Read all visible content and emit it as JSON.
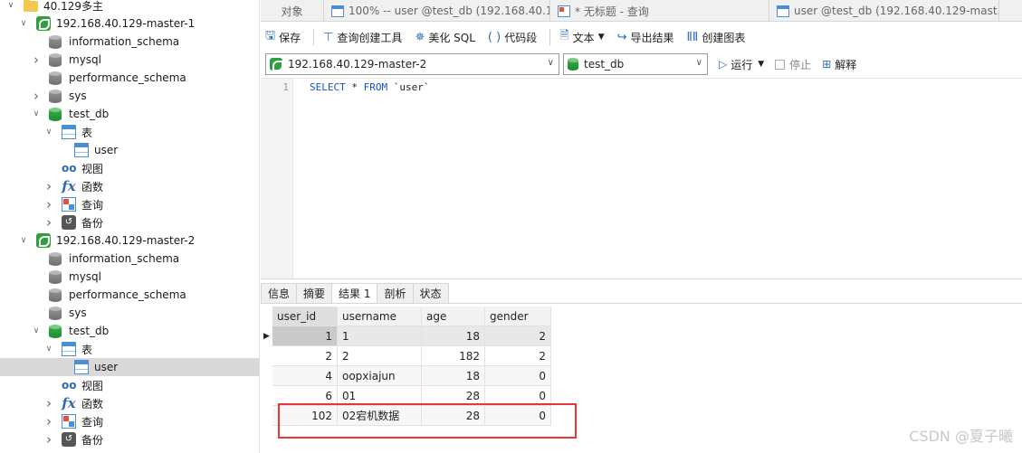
{
  "tree": {
    "items": [
      {
        "label": "40.129多主",
        "icon": "folder",
        "chev": "down",
        "indent": 0
      },
      {
        "label": "192.168.40.129-master-1",
        "icon": "connection",
        "chev": "down",
        "indent": 1
      },
      {
        "label": "information_schema",
        "icon": "db-gray",
        "chev": "",
        "indent": 2
      },
      {
        "label": "mysql",
        "icon": "db-gray",
        "chev": "right",
        "indent": 2
      },
      {
        "label": "performance_schema",
        "icon": "db-gray",
        "chev": "",
        "indent": 2
      },
      {
        "label": "sys",
        "icon": "db-gray",
        "chev": "right",
        "indent": 2
      },
      {
        "label": "test_db",
        "icon": "db-green",
        "chev": "down",
        "indent": 2
      },
      {
        "label": "表",
        "icon": "table",
        "chev": "down",
        "indent": 3
      },
      {
        "label": "user",
        "icon": "table",
        "chev": "",
        "indent": 4
      },
      {
        "label": "视图",
        "icon": "view",
        "chev": "",
        "indent": 3
      },
      {
        "label": "函数",
        "icon": "function",
        "chev": "right",
        "indent": 3
      },
      {
        "label": "查询",
        "icon": "query",
        "chev": "right",
        "indent": 3
      },
      {
        "label": "备份",
        "icon": "backup",
        "chev": "right",
        "indent": 3
      },
      {
        "label": "192.168.40.129-master-2",
        "icon": "connection",
        "chev": "down",
        "indent": 1
      },
      {
        "label": "information_schema",
        "icon": "db-gray",
        "chev": "",
        "indent": 2
      },
      {
        "label": "mysql",
        "icon": "db-gray",
        "chev": "",
        "indent": 2
      },
      {
        "label": "performance_schema",
        "icon": "db-gray",
        "chev": "",
        "indent": 2
      },
      {
        "label": "sys",
        "icon": "db-gray",
        "chev": "",
        "indent": 2
      },
      {
        "label": "test_db",
        "icon": "db-green",
        "chev": "down",
        "indent": 2
      },
      {
        "label": "表",
        "icon": "table",
        "chev": "down",
        "indent": 3
      },
      {
        "label": "user",
        "icon": "table",
        "chev": "",
        "indent": 4,
        "selected": true
      },
      {
        "label": "视图",
        "icon": "view",
        "chev": "",
        "indent": 3
      },
      {
        "label": "函数",
        "icon": "function",
        "chev": "right",
        "indent": 3
      },
      {
        "label": "查询",
        "icon": "query",
        "chev": "right",
        "indent": 3
      },
      {
        "label": "备份",
        "icon": "backup",
        "chev": "right",
        "indent": 3
      }
    ]
  },
  "tabs": [
    {
      "label": "对象",
      "icon": ""
    },
    {
      "label": "100% -- user @test_db (192.168.40.1...",
      "icon": "table"
    },
    {
      "label": "* 无标题 - 查询",
      "icon": "query"
    },
    {
      "label": "user @test_db (192.168.40.129-mast...",
      "icon": "table"
    }
  ],
  "toolbar": {
    "save": "保存",
    "query_builder": "查询创建工具",
    "beautify": "美化 SQL",
    "snippet": "代码段",
    "text": "文本",
    "export": "导出结果",
    "chart": "创建图表"
  },
  "controls": {
    "connection": "192.168.40.129-master-2",
    "database": "test_db",
    "run": "运行",
    "stop": "停止",
    "explain": "解释"
  },
  "editor": {
    "line_number": "1",
    "keyword_select": "SELECT",
    "star": " * ",
    "keyword_from": "FROM",
    "table": " `user`"
  },
  "result_tabs": [
    "信息",
    "摘要",
    "结果 1",
    "剖析",
    "状态"
  ],
  "grid": {
    "columns": [
      "user_id",
      "username",
      "age",
      "gender"
    ],
    "rows": [
      [
        "1",
        "1",
        "18",
        "2"
      ],
      [
        "2",
        "2",
        "182",
        "2"
      ],
      [
        "4",
        "oopxiajun",
        "18",
        "0"
      ],
      [
        "6",
        "01",
        "28",
        "0"
      ],
      [
        "102",
        "02宕机数据",
        "28",
        "0"
      ]
    ]
  },
  "watermark": "CSDN @夏子曦",
  "colors": {
    "highlight": "#e8353a",
    "accent": "#2d6bb5",
    "db_green": "#2e9e3e"
  }
}
